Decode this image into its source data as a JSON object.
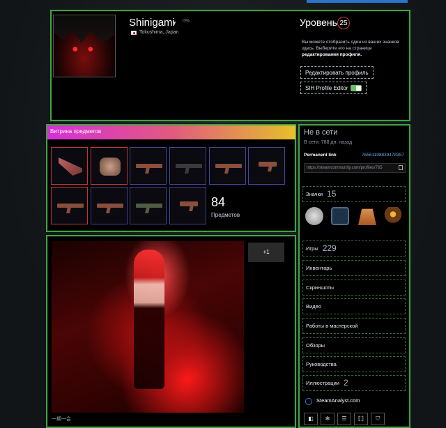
{
  "profile": {
    "name": "Shinigami",
    "percent": "0%",
    "location": "Tokushima, Japan"
  },
  "level": {
    "title": "Уровень",
    "value": "25",
    "desc": "Вы можете отобразить один из ваших значков здесь. Выберите его на странице",
    "desc_link": "редактирования профиля",
    "edit_button": "Редактировать профиль",
    "sih_button": "SIH Profile Editor"
  },
  "showcase": {
    "title": "Витрина предметов",
    "count": "84",
    "count_label": "Предметов",
    "items": [
      "knife",
      "gloves",
      "sniper",
      "ak47",
      "ak47",
      "pistol",
      "mp9",
      "rifle",
      "m4",
      "pistol"
    ]
  },
  "artwork": {
    "extra": "+1",
    "caption": "一期一会"
  },
  "sidebar": {
    "status": "Не в сети",
    "last_seen": "В сети: 788 дн. назад",
    "perm_label": "Permanent link",
    "perm_code": "76561198839478357",
    "url": "https://steamcommunity.com/profiles/765",
    "badges_label": "Значки",
    "badges_count": "15",
    "games_label": "Игры",
    "games_count": "229",
    "inventory": "Инвентарь",
    "screenshots": "Скриншоты",
    "videos": "Видео",
    "workshop": "Работы в мастерской",
    "reviews": "Обзоры",
    "guides": "Руководства",
    "artwork_label": "Иллюстрации",
    "artwork_count": "2",
    "analyst": "SteamAnalyst.com"
  }
}
